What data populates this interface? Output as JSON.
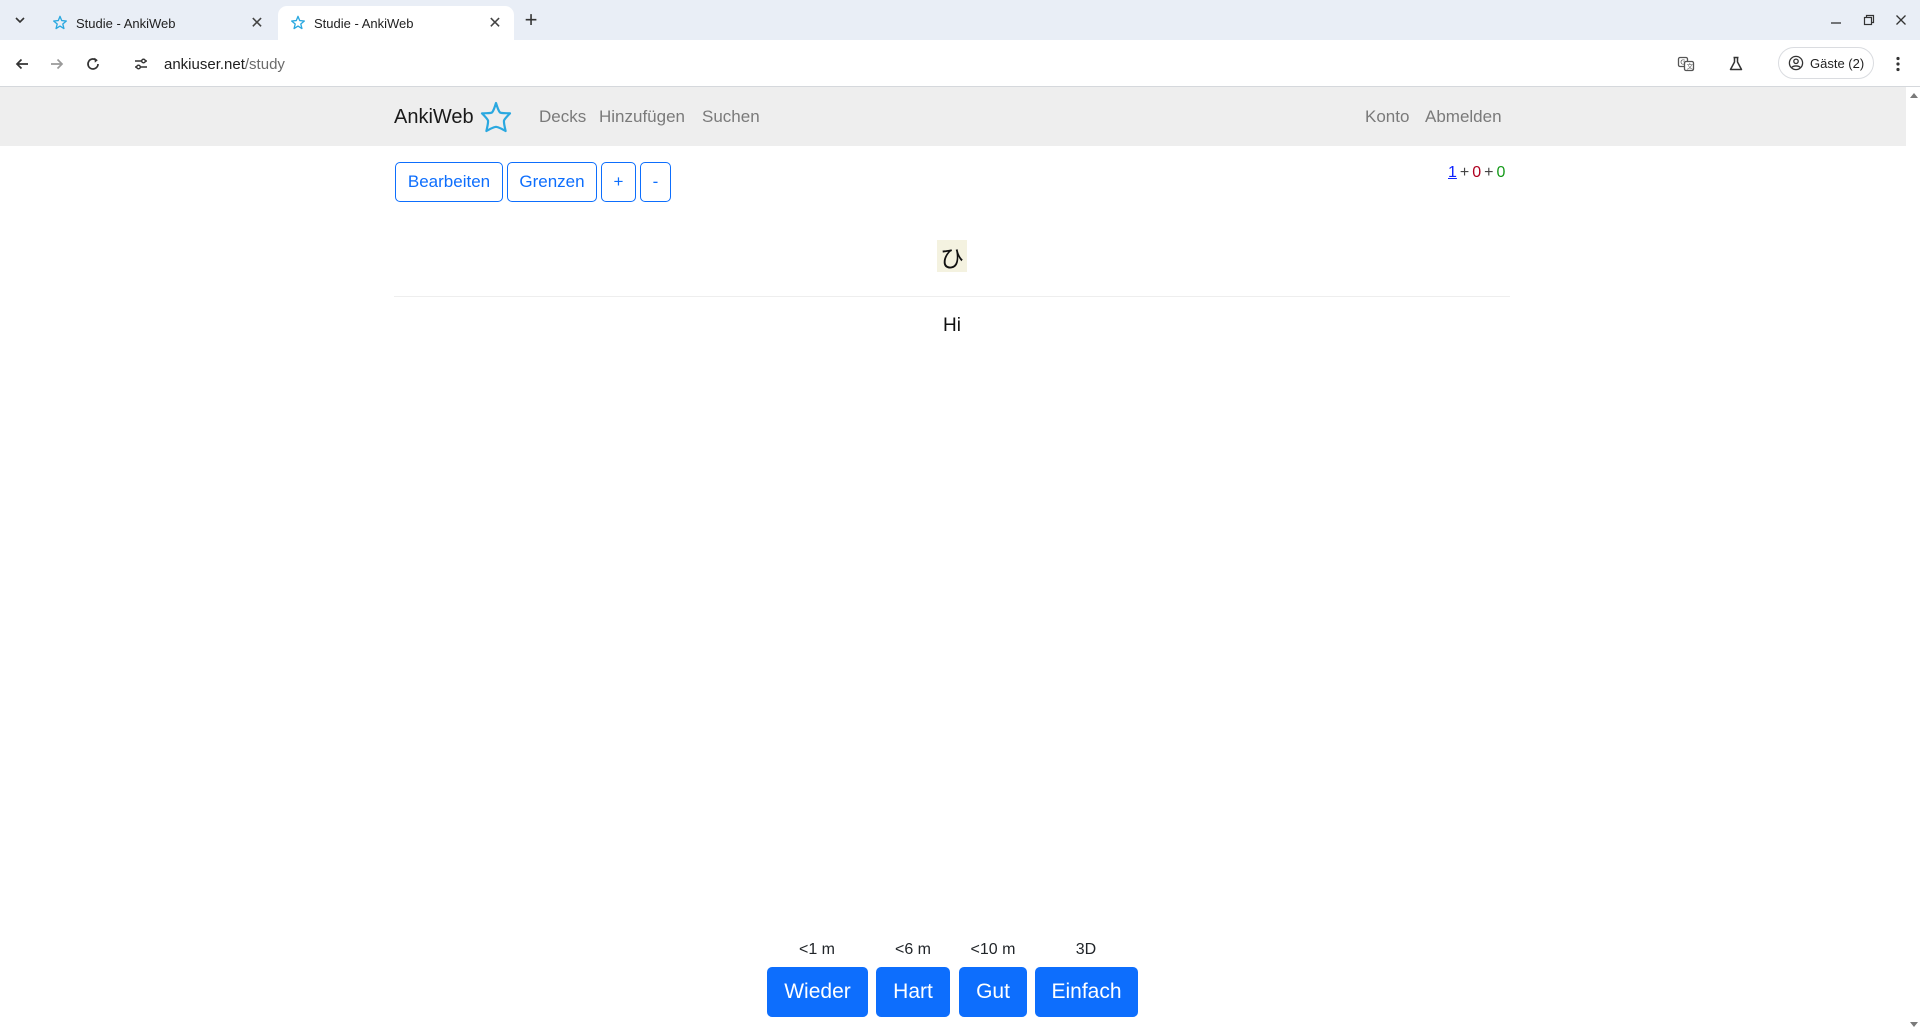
{
  "browser": {
    "tabs": [
      {
        "title": "Studie - AnkiWeb",
        "active": false
      },
      {
        "title": "Studie - AnkiWeb",
        "active": true
      }
    ],
    "url": {
      "host": "ankiuser.net",
      "path": "/study"
    },
    "profile_label": "Gäste (2)",
    "icons": [
      "tab-list-icon",
      "close-icon",
      "new-tab-icon",
      "minimize-icon",
      "restore-icon",
      "window-close-icon",
      "back-icon",
      "forward-icon",
      "reload-icon",
      "site-info-icon",
      "translate-icon",
      "labs-icon",
      "profile-icon",
      "menu-icon"
    ]
  },
  "app": {
    "brand": "AnkiWeb",
    "nav_left": [
      "Decks",
      "Hinzufügen",
      "Suchen"
    ],
    "nav_right": [
      "Konto",
      "Abmelden"
    ],
    "accent_color": "#0d6efd",
    "brand_star_color": "#2aa8e0"
  },
  "study": {
    "toolbar": {
      "edit_label": "Bearbeiten",
      "limits_label": "Grenzen",
      "plus_label": "+",
      "minus_label": "-"
    },
    "counts": {
      "new": "1",
      "plus1": "+",
      "learn": "0",
      "plus2": "+",
      "review": "0",
      "colors": {
        "new": "#0d22ff",
        "learn": "#b00020",
        "review": "#159a1a"
      }
    },
    "card": {
      "front": "ひ",
      "back": "Hi"
    },
    "answers": [
      {
        "interval": "<1 m",
        "label": "Wieder"
      },
      {
        "interval": "<6 m",
        "label": "Hart"
      },
      {
        "interval": "<10 m",
        "label": "Gut"
      },
      {
        "interval": "3D",
        "label": "Einfach"
      }
    ]
  }
}
